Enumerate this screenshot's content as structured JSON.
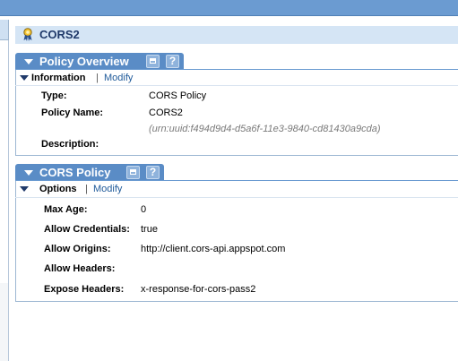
{
  "header": {
    "title": "CORS2",
    "icon": "policy-award-icon"
  },
  "policy_overview": {
    "title": "Policy Overview",
    "section": {
      "label": "Information",
      "separator": "|",
      "modify_link": "Modify"
    },
    "fields": {
      "type_label": "Type:",
      "type_value": "CORS Policy",
      "name_label": "Policy Name:",
      "name_value": "CORS2",
      "urn": "(urn:uuid:f494d9d4-d5a6f-11e3-9840-cd81430a9cda)",
      "description_label": "Description:"
    }
  },
  "cors_policy": {
    "title": "CORS Policy",
    "section": {
      "label": "Options",
      "separator": "|",
      "modify_link": "Modify"
    },
    "fields": [
      {
        "label": "Max Age:",
        "value": "0"
      },
      {
        "label": "Allow Credentials:",
        "value": "true"
      },
      {
        "label": "Allow Origins:",
        "value": "http://client.cors-api.appspot.com"
      },
      {
        "label": "Allow Headers:",
        "value": ""
      },
      {
        "label": "Expose Headers:",
        "value": "x-response-for-cors-pass2"
      }
    ]
  },
  "buttons": {
    "help": "?"
  },
  "colors": {
    "tab_blue": "#5a8cc6",
    "header_blue": "#d5e5f5",
    "topbar": "#6b9bd1",
    "link": "#1f5a9a"
  }
}
